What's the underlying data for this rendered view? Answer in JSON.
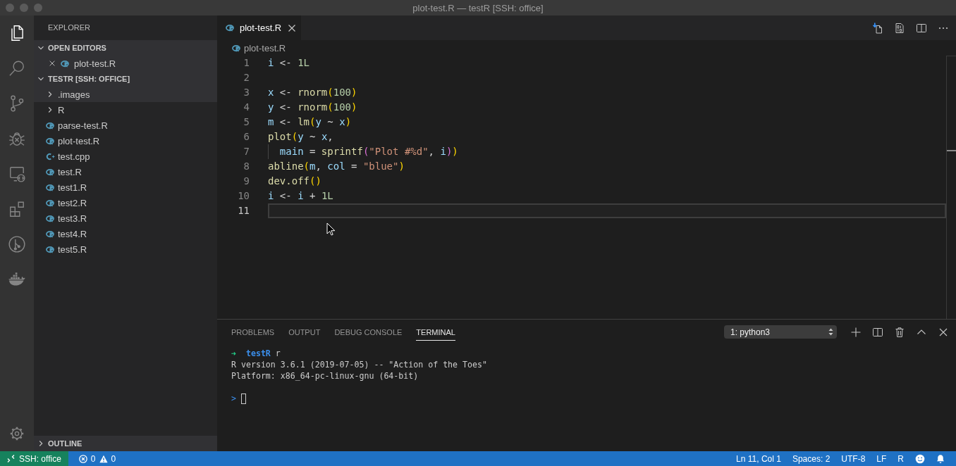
{
  "window": {
    "title": "plot-test.R — testR [SSH: office]"
  },
  "activity_bar": {
    "items": [
      {
        "kind": "explorer",
        "selected": true
      },
      {
        "kind": "search",
        "selected": false
      },
      {
        "kind": "source_control",
        "selected": false
      },
      {
        "kind": "debug",
        "selected": false
      },
      {
        "kind": "remote",
        "selected": false
      },
      {
        "kind": "extensions",
        "selected": false
      },
      {
        "kind": "git_graph",
        "selected": false
      },
      {
        "kind": "docker",
        "selected": false
      }
    ]
  },
  "sidebar": {
    "title": "EXPLORER",
    "open_editors": {
      "title": "OPEN EDITORS",
      "expanded": true,
      "items": [
        {
          "label": "plot-test.R",
          "kind": "r",
          "selected": true
        }
      ]
    },
    "folder": {
      "title": "TESTR [SSH: OFFICE]",
      "expanded": true,
      "items": [
        {
          "label": ".images",
          "kind": "folder",
          "expanded": false,
          "selected": true
        },
        {
          "label": "R",
          "kind": "folder",
          "expanded": false,
          "selected": false
        },
        {
          "label": "parse-test.R",
          "kind": "r",
          "selected": false
        },
        {
          "label": "plot-test.R",
          "kind": "r",
          "selected": false
        },
        {
          "label": "test.cpp",
          "kind": "cpp",
          "selected": false
        },
        {
          "label": "test.R",
          "kind": "r",
          "selected": false
        },
        {
          "label": "test1.R",
          "kind": "r",
          "selected": false
        },
        {
          "label": "test2.R",
          "kind": "r",
          "selected": false
        },
        {
          "label": "test3.R",
          "kind": "r",
          "selected": false
        },
        {
          "label": "test4.R",
          "kind": "r",
          "selected": false
        },
        {
          "label": "test5.R",
          "kind": "r",
          "selected": false
        }
      ]
    },
    "outline": {
      "title": "OUTLINE",
      "expanded": false
    }
  },
  "editor": {
    "tabs": [
      {
        "label": "plot-test.R",
        "kind": "r",
        "selected": true
      }
    ],
    "breadcrumb": {
      "label": "plot-test.R",
      "kind": "r"
    },
    "lines": [
      {
        "number": "1",
        "current": false,
        "indented": false,
        "tokens": [
          {
            "text": "i",
            "kind": "variable"
          },
          {
            "text": " <- ",
            "kind": "operator"
          },
          {
            "text": "1L",
            "kind": "number"
          }
        ]
      },
      {
        "number": "2",
        "current": false,
        "indented": false
      },
      {
        "number": "3",
        "current": false,
        "indented": false,
        "tokens": [
          {
            "text": "x",
            "kind": "variable"
          },
          {
            "text": " <- ",
            "kind": "operator"
          },
          {
            "text": "rnorm",
            "kind": "function"
          },
          {
            "text": "(",
            "kind": "bracket1"
          },
          {
            "text": "100",
            "kind": "number"
          },
          {
            "text": ")",
            "kind": "bracket1"
          }
        ]
      },
      {
        "number": "4",
        "current": false,
        "indented": false,
        "tokens": [
          {
            "text": "y",
            "kind": "variable"
          },
          {
            "text": " <- ",
            "kind": "operator"
          },
          {
            "text": "rnorm",
            "kind": "function"
          },
          {
            "text": "(",
            "kind": "bracket1"
          },
          {
            "text": "100",
            "kind": "number"
          },
          {
            "text": ")",
            "kind": "bracket1"
          }
        ]
      },
      {
        "number": "5",
        "current": false,
        "indented": false,
        "tokens": [
          {
            "text": "m",
            "kind": "variable"
          },
          {
            "text": " <- ",
            "kind": "operator"
          },
          {
            "text": "lm",
            "kind": "function"
          },
          {
            "text": "(",
            "kind": "bracket1"
          },
          {
            "text": "y",
            "kind": "variable"
          },
          {
            "text": " ~ ",
            "kind": "operator"
          },
          {
            "text": "x",
            "kind": "variable"
          },
          {
            "text": ")",
            "kind": "bracket1"
          }
        ]
      },
      {
        "number": "6",
        "current": false,
        "indented": false,
        "tokens": [
          {
            "text": "plot",
            "kind": "function"
          },
          {
            "text": "(",
            "kind": "bracket1"
          },
          {
            "text": "y",
            "kind": "variable"
          },
          {
            "text": " ~ ",
            "kind": "operator"
          },
          {
            "text": "x",
            "kind": "variable"
          },
          {
            "text": ",",
            "kind": "punctuation"
          }
        ]
      },
      {
        "number": "7",
        "current": false,
        "indented": true,
        "tokens": [
          {
            "text": "main",
            "kind": "variable"
          },
          {
            "text": " = ",
            "kind": "operator"
          },
          {
            "text": "sprintf",
            "kind": "function"
          },
          {
            "text": "(",
            "kind": "bracket2"
          },
          {
            "text": "\"Plot #%d\"",
            "kind": "string"
          },
          {
            "text": ", ",
            "kind": "punctuation"
          },
          {
            "text": "i",
            "kind": "variable"
          },
          {
            "text": ")",
            "kind": "bracket2"
          },
          {
            "text": ")",
            "kind": "bracket1"
          }
        ]
      },
      {
        "number": "8",
        "current": false,
        "indented": false,
        "tokens": [
          {
            "text": "abline",
            "kind": "function"
          },
          {
            "text": "(",
            "kind": "bracket1"
          },
          {
            "text": "m",
            "kind": "variable"
          },
          {
            "text": ", ",
            "kind": "punctuation"
          },
          {
            "text": "col",
            "kind": "variable"
          },
          {
            "text": " = ",
            "kind": "operator"
          },
          {
            "text": "\"blue\"",
            "kind": "string"
          },
          {
            "text": ")",
            "kind": "bracket1"
          }
        ]
      },
      {
        "number": "9",
        "current": false,
        "indented": false,
        "tokens": [
          {
            "text": "dev.off",
            "kind": "function"
          },
          {
            "text": "()",
            "kind": "bracket1"
          }
        ]
      },
      {
        "number": "10",
        "current": false,
        "indented": false,
        "tokens": [
          {
            "text": "i",
            "kind": "variable"
          },
          {
            "text": " <- ",
            "kind": "operator"
          },
          {
            "text": "i",
            "kind": "variable"
          },
          {
            "text": " + ",
            "kind": "operator"
          },
          {
            "text": "1L",
            "kind": "number"
          }
        ]
      },
      {
        "number": "11",
        "current": true,
        "indented": false
      }
    ]
  },
  "panel": {
    "tabs": [
      {
        "label": "PROBLEMS",
        "selected": false
      },
      {
        "label": "OUTPUT",
        "selected": false
      },
      {
        "label": "DEBUG CONSOLE",
        "selected": false
      },
      {
        "label": "TERMINAL",
        "selected": true
      }
    ],
    "terminal_picker": {
      "value": "1: python3"
    },
    "terminal": {
      "lines": [
        {
          "segments": [
            {
              "text": "➜",
              "kind": "arrow"
            },
            {
              "text": "  testR",
              "kind": "directory"
            },
            {
              "text": " r",
              "kind": "plain"
            }
          ]
        },
        {
          "segments": [
            {
              "text": "R version 3.6.1 (2019-07-05) -- \"Action of the Toes\"",
              "kind": "plain"
            }
          ]
        },
        {
          "segments": [
            {
              "text": "Platform: x86_64-pc-linux-gnu (64-bit)",
              "kind": "plain"
            }
          ]
        }
      ],
      "prompt": ">"
    }
  },
  "status_bar": {
    "remote": "SSH: office",
    "errors": "0",
    "warnings": "0",
    "items": [
      "Ln 11, Col 1",
      "Spaces: 2",
      "UTF-8",
      "LF",
      "R"
    ]
  }
}
